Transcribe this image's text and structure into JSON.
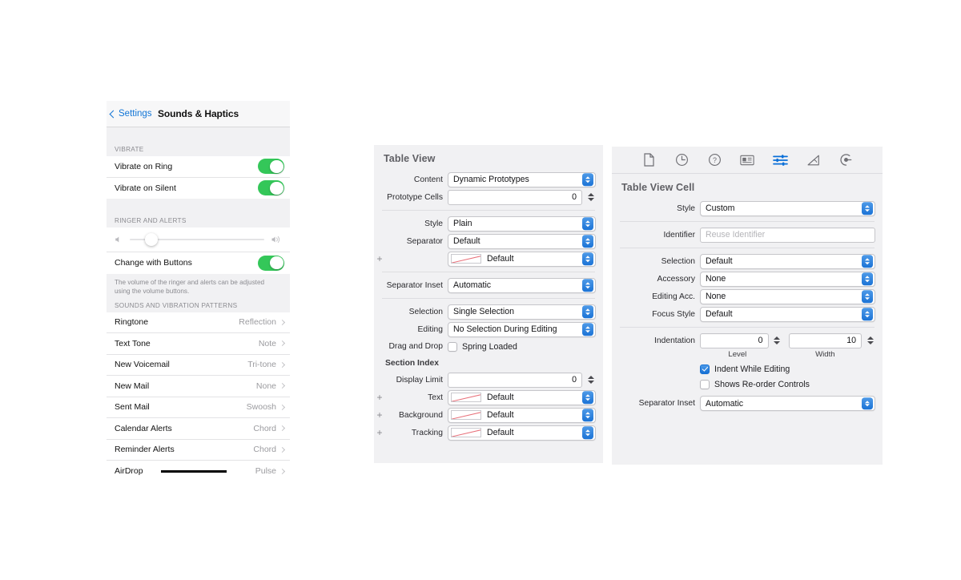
{
  "ios_settings": {
    "back_label": "Settings",
    "title": "Sounds & Haptics",
    "sections": [
      {
        "header": "VIBRATE",
        "rows": [
          {
            "label": "Vibrate on Ring",
            "control": "toggle",
            "state": "on"
          },
          {
            "label": "Vibrate on Silent",
            "control": "toggle",
            "state": "on"
          }
        ]
      },
      {
        "header": "RINGER AND ALERTS",
        "slider": {
          "value_percent": 16,
          "left_icon": "speaker-low-icon",
          "right_icon": "speaker-high-icon"
        },
        "rows": [
          {
            "label": "Change with Buttons",
            "control": "toggle",
            "state": "on"
          }
        ],
        "footnote": "The volume of the ringer and alerts can be adjusted using the volume buttons."
      },
      {
        "header": "SOUNDS AND VIBRATION PATTERNS",
        "rows": [
          {
            "label": "Ringtone",
            "value": "Reflection"
          },
          {
            "label": "Text Tone",
            "value": "Note"
          },
          {
            "label": "New Voicemail",
            "value": "Tri-tone"
          },
          {
            "label": "New Mail",
            "value": "None"
          },
          {
            "label": "Sent Mail",
            "value": "Swoosh"
          },
          {
            "label": "Calendar Alerts",
            "value": "Chord"
          },
          {
            "label": "Reminder Alerts",
            "value": "Chord"
          },
          {
            "label": "AirDrop",
            "value": "Pulse",
            "redacted": true
          }
        ]
      }
    ]
  },
  "table_view_inspector": {
    "title": "Table View",
    "rows": {
      "content_label": "Content",
      "content_value": "Dynamic Prototypes",
      "prototype_cells_label": "Prototype Cells",
      "prototype_cells_value": "0",
      "style_label": "Style",
      "style_value": "Plain",
      "separator_label": "Separator",
      "separator_value": "Default",
      "separator_color_value": "Default",
      "separator_inset_label": "Separator Inset",
      "separator_inset_value": "Automatic",
      "selection_label": "Selection",
      "selection_value": "Single Selection",
      "editing_label": "Editing",
      "editing_value": "No Selection During Editing",
      "drag_and_drop_label": "Drag and Drop",
      "spring_loaded_label": "Spring Loaded",
      "spring_loaded_state": "off",
      "section_index_header": "Section Index",
      "display_limit_label": "Display Limit",
      "display_limit_value": "0",
      "text_label": "Text",
      "text_value": "Default",
      "background_label": "Background",
      "background_value": "Default",
      "tracking_label": "Tracking",
      "tracking_value": "Default",
      "add_symbol": "+"
    }
  },
  "table_view_cell_inspector": {
    "toolbar_icons": [
      {
        "name": "file-inspector-icon",
        "active": false
      },
      {
        "name": "history-inspector-icon",
        "active": false
      },
      {
        "name": "quick-help-inspector-icon",
        "active": false
      },
      {
        "name": "identity-inspector-icon",
        "active": false
      },
      {
        "name": "attributes-inspector-icon",
        "active": true
      },
      {
        "name": "size-inspector-icon",
        "active": false
      },
      {
        "name": "connections-inspector-icon",
        "active": false
      }
    ],
    "title": "Table View Cell",
    "rows": {
      "style_label": "Style",
      "style_value": "Custom",
      "identifier_label": "Identifier",
      "identifier_value": "",
      "identifier_placeholder": "Reuse Identifier",
      "selection_label": "Selection",
      "selection_value": "Default",
      "accessory_label": "Accessory",
      "accessory_value": "None",
      "editing_acc_label": "Editing Acc.",
      "editing_acc_value": "None",
      "focus_style_label": "Focus Style",
      "focus_style_value": "Default",
      "indentation_label": "Indentation",
      "indentation_level_value": "0",
      "indentation_width_value": "10",
      "level_caption": "Level",
      "width_caption": "Width",
      "indent_while_editing_label": "Indent While Editing",
      "indent_while_editing_state": "on",
      "shows_reorder_label": "Shows Re-order Controls",
      "shows_reorder_state": "off",
      "separator_inset_label": "Separator Inset",
      "separator_inset_value": "Automatic"
    }
  },
  "colors": {
    "ios_toggle_on": "#34c759",
    "ios_link": "#1175d6",
    "xcode_accent": "#1b73d6",
    "panel_bg": "#f1f1f3",
    "swatch_line": "#e8707a"
  }
}
